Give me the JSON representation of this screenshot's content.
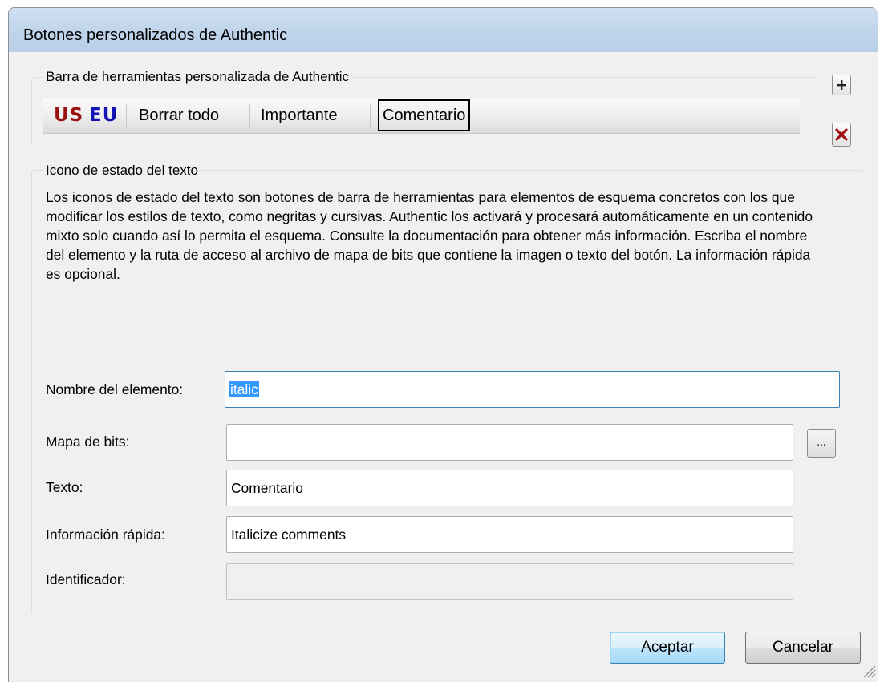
{
  "window": {
    "title": "Botones personalizados de Authentic"
  },
  "toolbar_group": {
    "legend": "Barra de herramientas personalizada de Authentic",
    "buttons": [
      {
        "label": "US",
        "color": "#9b1010"
      },
      {
        "label": "EU",
        "color": "#1414b4"
      },
      {
        "label": "Borrar todo"
      },
      {
        "label": "Importante"
      },
      {
        "label": "Comentario",
        "selected": true
      }
    ],
    "add_icon": "plus-icon",
    "delete_icon": "red-x-icon",
    "delete_color": "#a01010"
  },
  "status_group": {
    "legend": "Icono de estado del texto",
    "description": "Los iconos de estado del texto son botones de barra de herramientas para elementos de esquema concretos con los que modificar los estilos de texto, como negritas y cursivas. Authentic los activará y procesará automáticamente en un contenido mixto solo cuando así lo permita el esquema. Consulte la documentación para obtener más información. Escriba el nombre del elemento y la ruta de acceso al archivo de mapa de bits que contiene la imagen o texto del botón. La información rápida es opcional.",
    "fields": {
      "element_name": {
        "label": "Nombre del elemento:",
        "value": "italic"
      },
      "bitmap": {
        "label": "Mapa de bits:",
        "value": "",
        "browse_label": "..."
      },
      "text": {
        "label": "Texto:",
        "value": "Comentario"
      },
      "tooltip": {
        "label": "Información rápida:",
        "value": "Italicize comments"
      },
      "identifier": {
        "label": "Identificador:",
        "value": ""
      }
    }
  },
  "footer": {
    "ok_label": "Aceptar",
    "cancel_label": "Cancelar"
  },
  "colors": {
    "accent": "#3c7fb1",
    "selection": "#3399ff"
  }
}
